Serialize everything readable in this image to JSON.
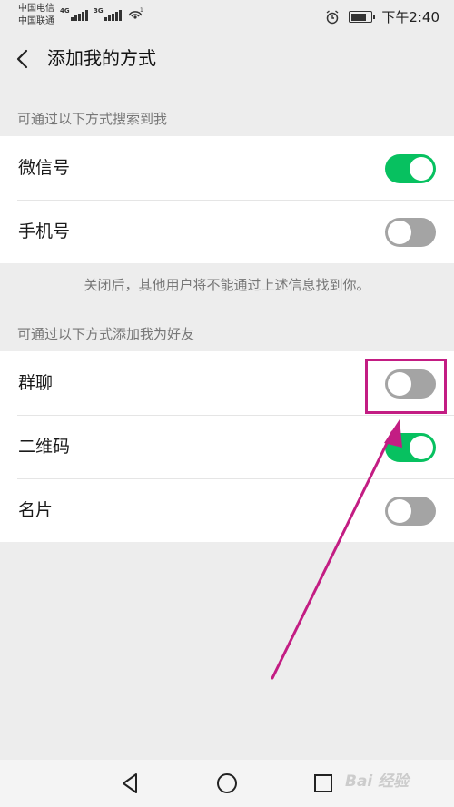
{
  "status_bar": {
    "carrier_1": "中国电信",
    "carrier_2": "中国联通",
    "network_1": "4G",
    "network_2": "3G",
    "wifi_badge": "1",
    "time": "下午2:40",
    "icons": [
      "signal-icon",
      "wifi-icon",
      "alarm-icon",
      "battery-icon"
    ]
  },
  "nav": {
    "title": "添加我的方式",
    "back_icon": "chevron-left-icon"
  },
  "search_section": {
    "label": "可通过以下方式搜索到我",
    "items": [
      {
        "label": "微信号",
        "enabled": true
      },
      {
        "label": "手机号",
        "enabled": false
      }
    ],
    "note": "关闭后，其他用户将不能通过上述信息找到你。"
  },
  "add_section": {
    "label": "可通过以下方式添加我为好友",
    "items": [
      {
        "label": "群聊",
        "enabled": false
      },
      {
        "label": "二维码",
        "enabled": true
      },
      {
        "label": "名片",
        "enabled": false
      }
    ]
  },
  "annotation": {
    "highlight_color": "#c31d83",
    "target": "群聊"
  },
  "system_nav": {
    "icons": [
      "back-triangle-icon",
      "home-circle-icon",
      "recents-square-icon"
    ]
  },
  "watermark": "Bai 经验",
  "colors": {
    "toggle_on": "#07c160",
    "toggle_off": "#a4a4a4",
    "background": "#ededed"
  }
}
